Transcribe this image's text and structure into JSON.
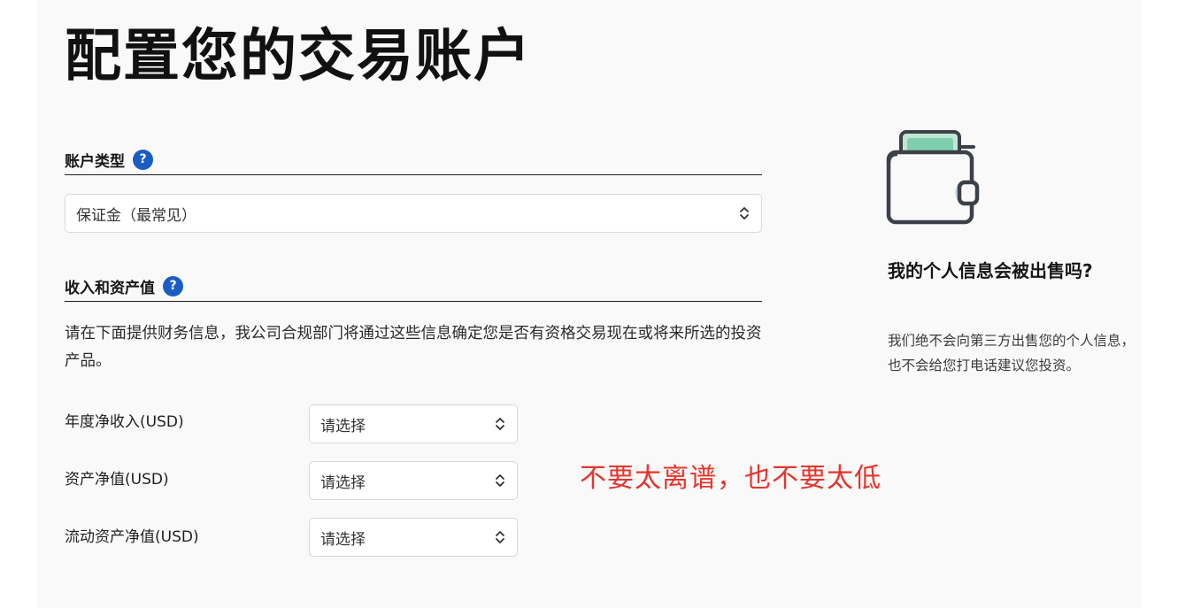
{
  "page": {
    "title": "配置您的交易账户"
  },
  "account_type": {
    "heading": "账户类型",
    "help_glyph": "?",
    "select_value": "保证金（最常见）"
  },
  "income_assets": {
    "heading": "收入和资产值",
    "help_glyph": "?",
    "description": "请在下面提供财务信息，我公司合规部门将通过这些信息确定您是否有资格交易现在或将来所选的投资产品。",
    "fields": [
      {
        "label": "年度净收入(USD)",
        "select_value": "请选择"
      },
      {
        "label": "资产净值(USD)",
        "select_value": "请选择"
      },
      {
        "label": "流动资产净值(USD)",
        "select_value": "请选择"
      }
    ]
  },
  "annotation": {
    "text": "不要太离谱，也不要太低",
    "color": "#e8352c"
  },
  "sidebar": {
    "icon": "wallet-icon",
    "title": "我的个人信息会被出售吗?",
    "text": "我们绝不会向第三方出售您的个人信息，也不会给您打电话建议您投资。"
  },
  "colors": {
    "accent": "#1a5cc4",
    "panel_background": "#f9f9fa",
    "wallet_card": "#bfe6d3"
  }
}
